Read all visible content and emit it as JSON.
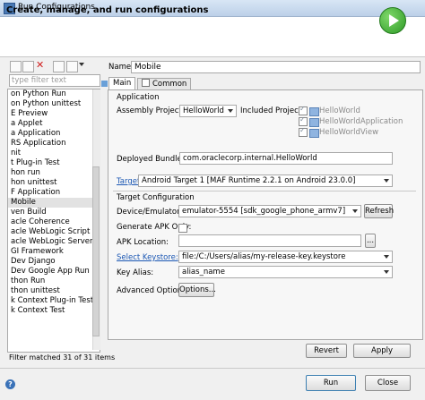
{
  "window": {
    "title": "Run Configurations"
  },
  "header": {
    "title": "Create, manage, and run configurations"
  },
  "left": {
    "filter_placeholder": "type filter text",
    "tree_items": [
      "on Python Run",
      "on Python unittest",
      "E Preview",
      "a Applet",
      "a Application",
      "RS Application",
      "nit",
      "t Plug-in Test",
      "hon run",
      "hon unittest",
      "F Application",
      "Mobile",
      "ven Build",
      "acle Coherence",
      "acle WebLogic Script (WLST",
      "acle WebLogic Server",
      "GI Framework",
      "Dev Django",
      "Dev Google App Run",
      "thon Run",
      "thon unittest",
      "k Context Plug-in Test",
      "k Context Test"
    ],
    "selected_index": 11,
    "status": "Filter matched 31 of 31 items"
  },
  "config": {
    "name_label": "Name:",
    "name_value": "Mobile",
    "tabs": [
      "Main",
      "Common"
    ],
    "application": {
      "section": "Application",
      "assembly_label": "Assembly Project:",
      "assembly_value": "HelloWorld",
      "included_label": "Included Projects:",
      "included_projects": [
        "HelloWorld",
        "HelloWorldApplication",
        "HelloWorldView"
      ],
      "bundle_label": "Deployed Bundle Id:",
      "bundle_value": "com.oraclecorp.internal.HelloWorld",
      "target_label": "Target:",
      "target_value": "Android Target 1 [MAF Runtime 2.2.1 on Android 23.0.0]"
    },
    "target_config": {
      "section": "Target Configuration",
      "device_label": "Device/Emulator:",
      "device_value": "emulator-5554 [sdk_google_phone_armv7]",
      "refresh_label": "Refresh",
      "generate_apk_label": "Generate APK Only:",
      "apk_location_label": "APK Location:",
      "apk_location_value": "",
      "browse_label": "...",
      "keystore_label": "Select Keystore:",
      "keystore_value": "file:/C:/Users/alias/my-release-key.keystore",
      "key_alias_label": "Key Alias:",
      "key_alias_value": "alias_name",
      "advanced_label": "Advanced Options:",
      "options_button": "Options..."
    },
    "revert_label": "Revert",
    "apply_label": "Apply"
  },
  "footer": {
    "run_label": "Run",
    "close_label": "Close"
  }
}
